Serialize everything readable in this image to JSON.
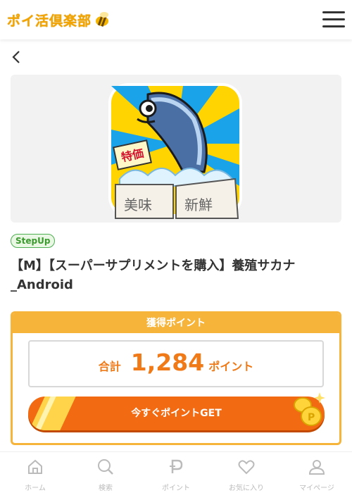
{
  "header": {
    "logo_text": "ポイ活倶楽部",
    "logo_icon": "bee-icon",
    "menu_icon": "hamburger-menu-icon"
  },
  "nav": {
    "back_icon": "chevron-left-icon"
  },
  "hero": {
    "image_icon": "fish-app-icon"
  },
  "offer": {
    "badge": "StepUp",
    "title": "【M】【スーパーサプリメントを購入】養殖サカナ_Android"
  },
  "points": {
    "header": "獲得ポイント",
    "total_label": "合計",
    "amount": "1,284",
    "unit": "ポイント",
    "cta_label": "今すぐポイントGET"
  },
  "colors": {
    "accent_orange": "#f26a12",
    "points_gold": "#f6b43a",
    "points_text": "#f07a17",
    "badge_green": "#4caf50"
  },
  "footer": {
    "items": [
      {
        "label": "ホーム",
        "icon": "home-icon"
      },
      {
        "label": "検索",
        "icon": "search-icon"
      },
      {
        "label": "ポイント",
        "icon": "point-icon"
      },
      {
        "label": "お気に入り",
        "icon": "heart-icon"
      },
      {
        "label": "マイページ",
        "icon": "user-icon"
      }
    ]
  }
}
